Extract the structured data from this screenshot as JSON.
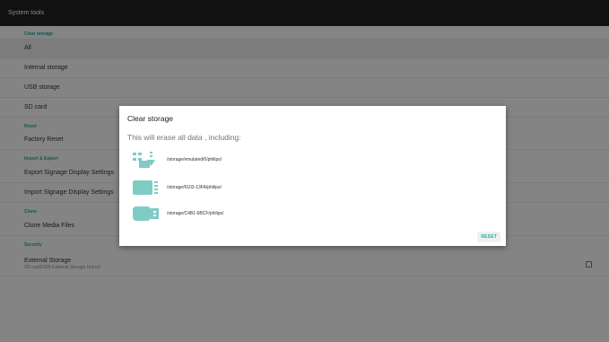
{
  "app": {
    "title": "System tools"
  },
  "sections": {
    "clear_storage": "Clear storage",
    "reset": "Reset",
    "import_export": "Import & Export",
    "clone": "Clone",
    "security": "Security"
  },
  "items": {
    "all": "All",
    "internal_storage": "Internal storage",
    "usb_storage": "USB storage",
    "sd_card": "SD card",
    "factory_reset": "Factory Reset",
    "export_settings": "Export Signage Display Settings",
    "import_settings": "Import Signage Display Settings",
    "clone_media_files": "Clone Media Files",
    "external_storage": "External Storage",
    "external_storage_sub": "SD card/USB External Storage Unlock"
  },
  "dialog": {
    "title": "Clear storage",
    "message": "This will erase all data , including:",
    "paths": [
      {
        "icon": "internal-storage-icon",
        "path": "/storage/emulated/0/philips/"
      },
      {
        "icon": "sd-card-icon",
        "path": "/storage/6103-13FA/philips/"
      },
      {
        "icon": "usb-drive-icon",
        "path": "/storage/C4B1-6BCF/philips/"
      }
    ],
    "reset_label": "RESET"
  },
  "colors": {
    "accent": "#26a69a",
    "topbar": "#212121",
    "icon": "#80cbc4"
  }
}
